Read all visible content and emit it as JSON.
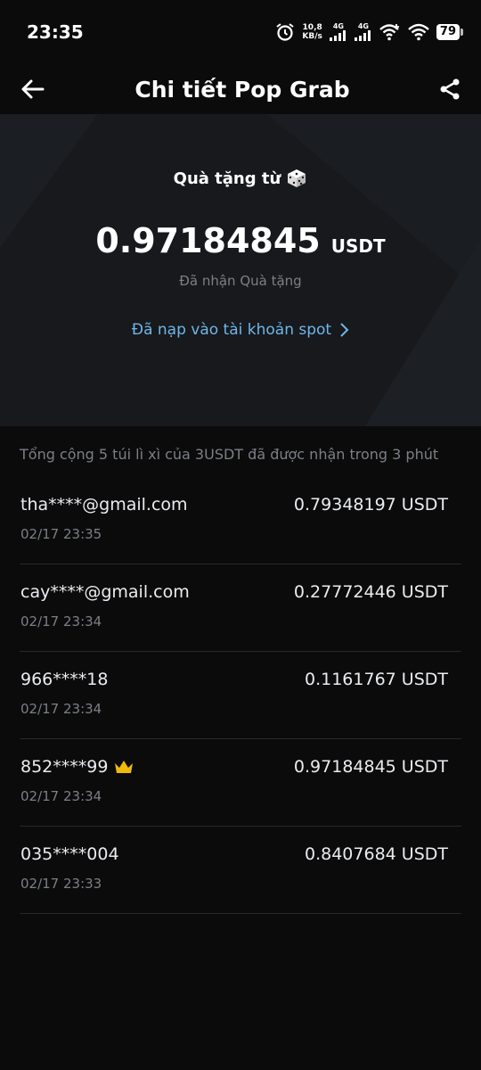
{
  "status_bar": {
    "time": "23:35",
    "net_speed_value": "10,8",
    "net_speed_unit": "KB/s",
    "signal1_label": "4G",
    "signal2_label": "4G",
    "battery": "79"
  },
  "header": {
    "title": "Chi tiết Pop Grab"
  },
  "hero": {
    "gift_from": "Quà tặng từ",
    "amount": "0.97184845",
    "unit": "USDT",
    "received_label": "Đã nhận Quà tặng",
    "spot_link": "Đã nạp vào tài khoản spot"
  },
  "summary": "Tổng cộng 5 túi lì xì của 3USDT đã được nhận trong 3 phút",
  "records": [
    {
      "user": "tha****@gmail.com",
      "amount": "0.79348197 USDT",
      "time": "02/17 23:35"
    },
    {
      "user": "cay****@gmail.com",
      "amount": "0.27772446 USDT",
      "time": "02/17 23:34"
    },
    {
      "user": "966****18",
      "amount": "0.1161767 USDT",
      "time": "02/17 23:34"
    },
    {
      "user": "852****99",
      "amount": "0.97184845 USDT",
      "time": "02/17 23:34",
      "crown": true
    },
    {
      "user": "035****004",
      "amount": "0.8407684 USDT",
      "time": "02/17 23:33"
    }
  ],
  "colors": {
    "background": "#0b0b0c",
    "hero_bg": "#17191d",
    "link": "#6fb6e8",
    "muted": "#7c7f86",
    "crown": "#f0b90b"
  }
}
